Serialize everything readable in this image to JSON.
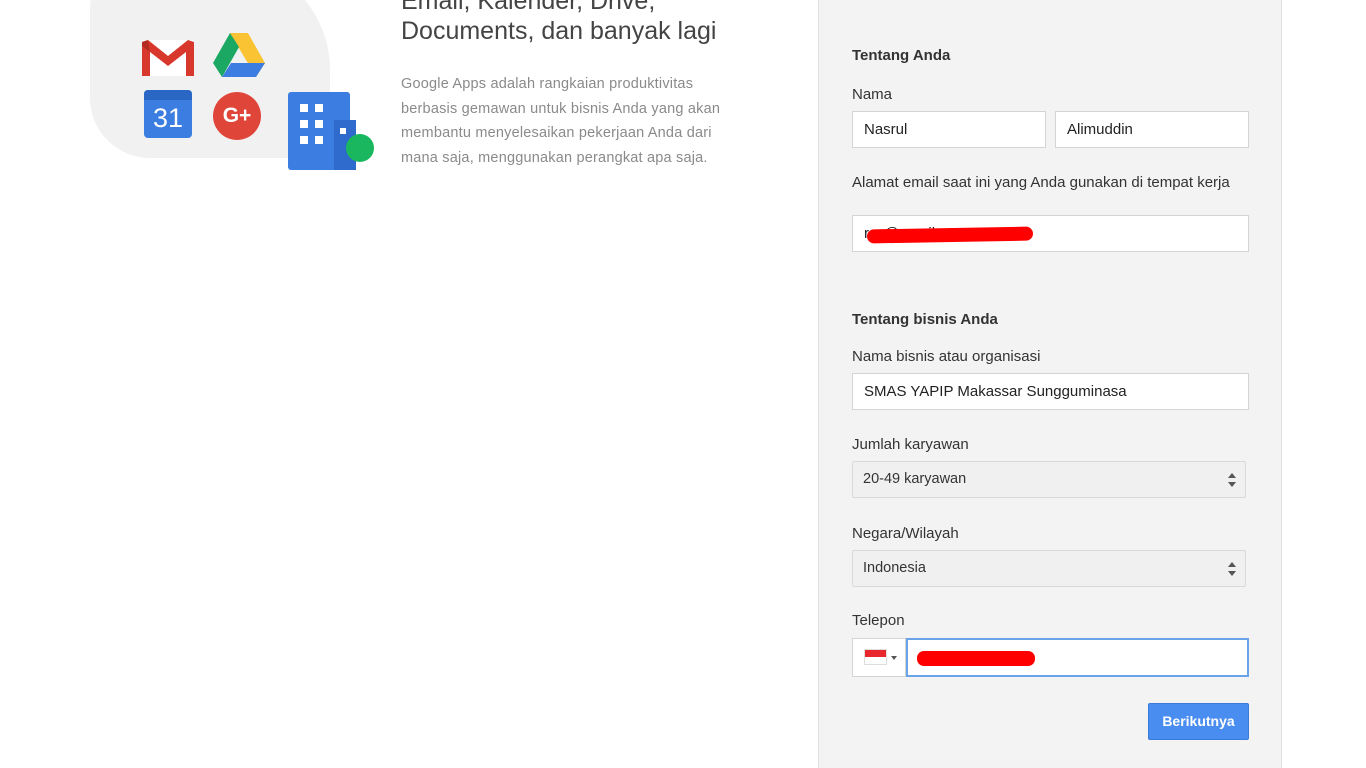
{
  "hero": {
    "title_line1": "Email, Kalender, Drive,",
    "title_line2": "Documents, dan banyak lagi",
    "description": "Google Apps adalah rangkaian produktivitas berbasis gemawan untuk bisnis Anda yang akan membantu menyelesaikan pekerjaan Anda dari mana saja, menggunakan perangkat apa saja.",
    "icons": [
      "gmail-icon",
      "google-drive-icon",
      "google-calendar-icon",
      "google-plus-icon",
      "building-icon"
    ],
    "calendar_number": "31",
    "gplus_text": "G+"
  },
  "form": {
    "about_you": {
      "section_title": "Tentang Anda",
      "name_label": "Nama",
      "first_name": "Nasrul",
      "last_name": "Alimuddin",
      "email_label": "Alamat email saat ini yang Anda gunakan di tempat kerja",
      "email_value": "r…@gmail.com"
    },
    "about_business": {
      "section_title": "Tentang bisnis Anda",
      "business_name_label": "Nama bisnis atau organisasi",
      "business_name": "SMAS YAPIP Makassar Sungguminasa",
      "employees_label": "Jumlah karyawan",
      "employees_value": "20-49 karyawan",
      "country_label": "Negara/Wilayah",
      "country_value": "Indonesia",
      "phone_label": "Telepon",
      "phone_flag": "Indonesia flag"
    },
    "next_button": "Berikutnya"
  },
  "colors": {
    "panel_bg": "#f3f3f3",
    "primary_button": "#4a8df0",
    "focus_border": "#6ba3e8",
    "redaction": "#ff0000"
  }
}
